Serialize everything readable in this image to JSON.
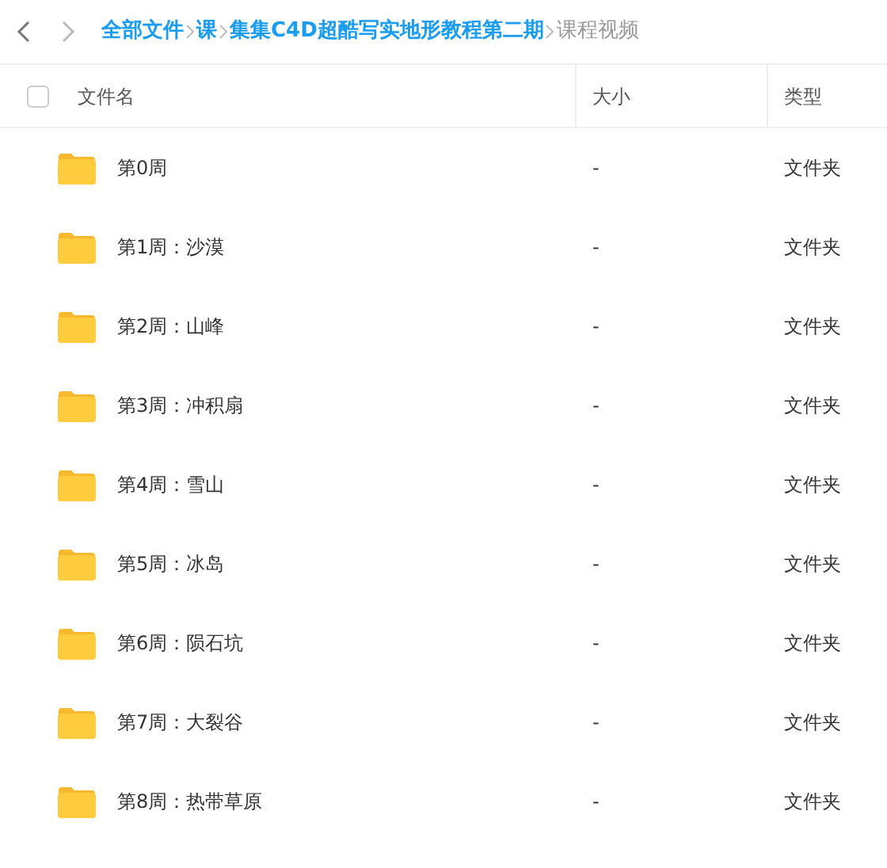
{
  "breadcrumb": [
    {
      "label": "全部文件",
      "current": false
    },
    {
      "label": "课",
      "current": false
    },
    {
      "label": "集集C4D超酷写实地形教程第二期",
      "current": false
    },
    {
      "label": "课程视频",
      "current": true
    }
  ],
  "table": {
    "select_all": {
      "checked": false
    },
    "columns": [
      "文件名",
      "大小",
      "类型"
    ],
    "rows": [
      {
        "name": "第0周",
        "size": "-",
        "type": "文件夹"
      },
      {
        "name": "第1周：沙漠",
        "size": "-",
        "type": "文件夹"
      },
      {
        "name": "第2周：山峰",
        "size": "-",
        "type": "文件夹"
      },
      {
        "name": "第3周：冲积扇",
        "size": "-",
        "type": "文件夹"
      },
      {
        "name": "第4周：雪山",
        "size": "-",
        "type": "文件夹"
      },
      {
        "name": "第5周：冰岛",
        "size": "-",
        "type": "文件夹"
      },
      {
        "name": "第6周：陨石坑",
        "size": "-",
        "type": "文件夹"
      },
      {
        "name": "第7周：大裂谷",
        "size": "-",
        "type": "文件夹"
      },
      {
        "name": "第8周：热带草原",
        "size": "-",
        "type": "文件夹"
      }
    ]
  }
}
